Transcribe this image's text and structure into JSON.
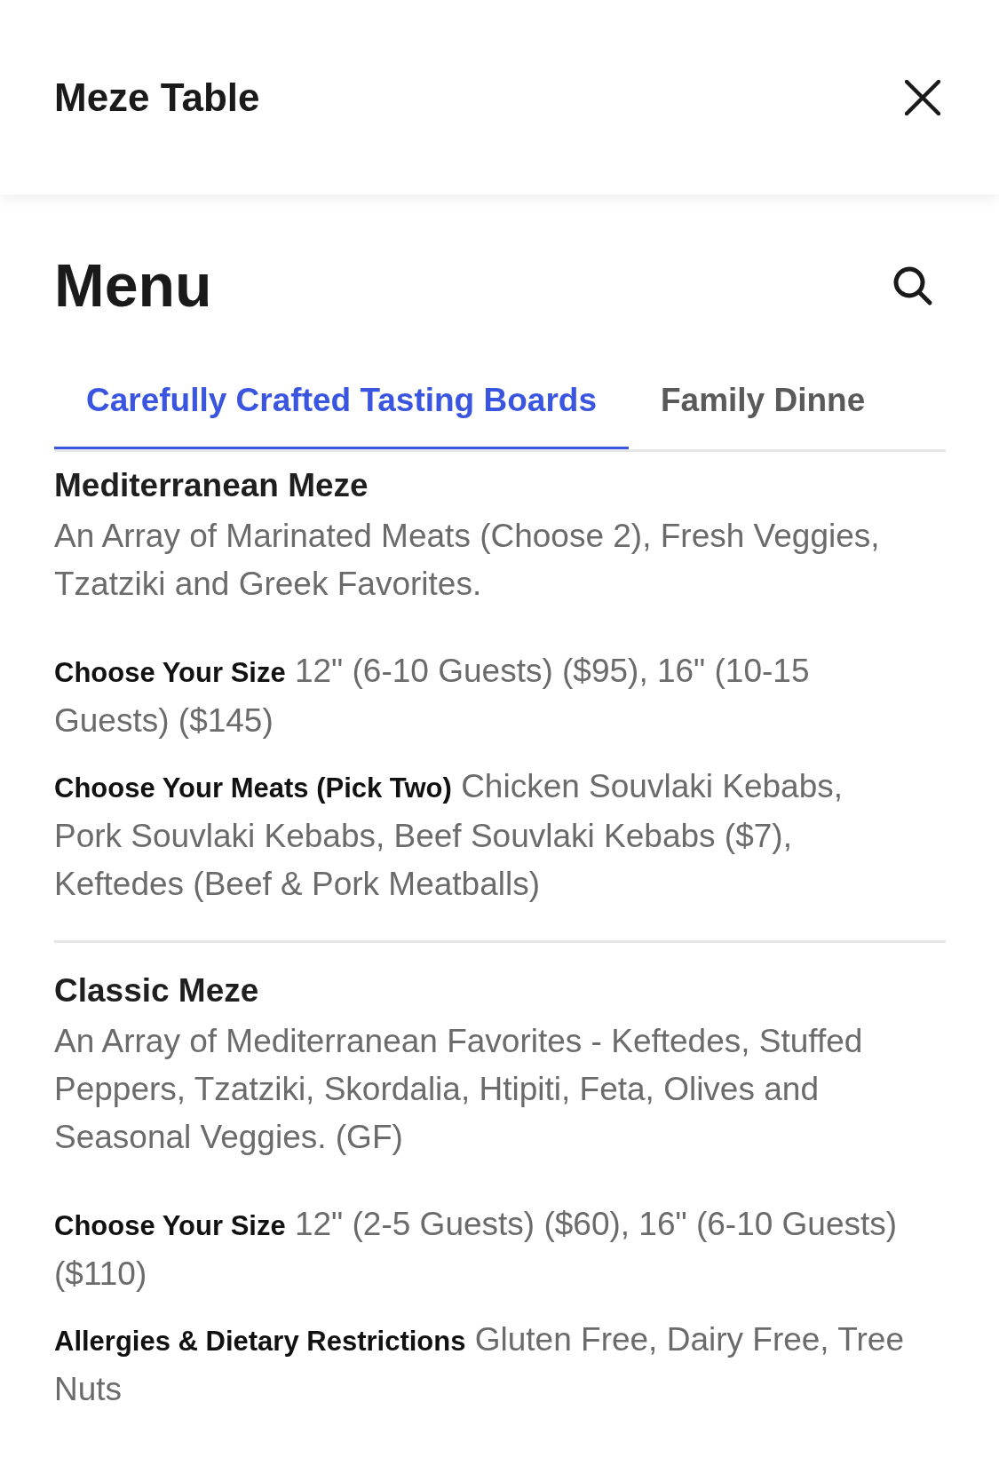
{
  "header": {
    "title": "Meze Table"
  },
  "menu": {
    "title": "Menu"
  },
  "tabs": [
    {
      "label": "Carefully Crafted Tasting Boards",
      "selected": true
    },
    {
      "label": "Family Dinne",
      "selected": false
    }
  ],
  "items": [
    {
      "name": "Mediterranean Meze",
      "description": "An Array of Marinated Meats (Choose 2), Fresh Veggies, Tzatziki and Greek Favorites.",
      "options": [
        {
          "label": "Choose Your Size",
          "value": "12\" (6-10 Guests) ($95), 16\" (10-15 Guests) ($145)"
        },
        {
          "label": "Choose Your Meats (Pick Two)",
          "value": "Chicken Souvlaki Kebabs, Pork Souvlaki Kebabs, Beef Souvlaki Kebabs ($7), Keftedes (Beef & Pork Meatballs)"
        }
      ]
    },
    {
      "name": "Classic Meze",
      "description": "An Array of Mediterranean Favorites - Keftedes, Stuffed Peppers, Tzatziki, Skordalia, Htipiti, Feta, Olives and Seasonal Veggies. (GF)",
      "options": [
        {
          "label": "Choose Your Size",
          "value": "12\" (2-5 Guests) ($60), 16\" (6-10 Guests) ($110)"
        },
        {
          "label": "Allergies & Dietary Restrictions",
          "value": "Gluten Free, Dairy Free, Tree Nuts"
        }
      ]
    }
  ]
}
